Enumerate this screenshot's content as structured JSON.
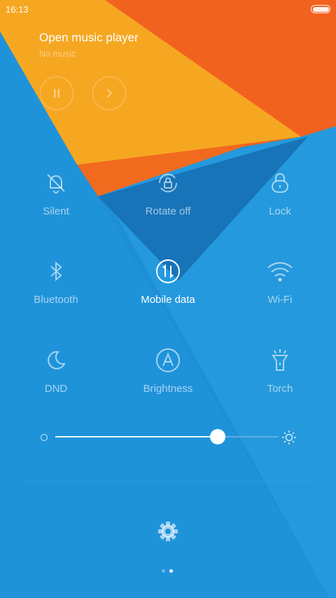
{
  "status_bar": {
    "time": "16:13",
    "battery_icon": "battery-icon"
  },
  "music": {
    "title": "Open music player",
    "subtitle": "No music",
    "pause_icon": "pause-icon",
    "next_icon": "next-icon"
  },
  "toggles": [
    {
      "label": "Silent",
      "icon": "bell-off-icon",
      "active": false
    },
    {
      "label": "Rotate off",
      "icon": "rotate-lock-icon",
      "active": false
    },
    {
      "label": "Lock",
      "icon": "lock-icon",
      "active": false
    },
    {
      "label": "Bluetooth",
      "icon": "bluetooth-icon",
      "active": false
    },
    {
      "label": "Mobile data",
      "icon": "mobile-data-icon",
      "active": true
    },
    {
      "label": "Wi-Fi",
      "icon": "wifi-icon",
      "active": false
    },
    {
      "label": "DND",
      "icon": "moon-icon",
      "active": false
    },
    {
      "label": "Brightness",
      "icon": "auto-brightness-icon",
      "active": false
    },
    {
      "label": "Torch",
      "icon": "torch-icon",
      "active": false
    }
  ],
  "brightness": {
    "level": 0.73,
    "min_icon": "brightness-low-icon",
    "max_icon": "brightness-high-icon"
  },
  "settings_icon": "gear-icon",
  "pager": {
    "pages": 2,
    "current": 2
  },
  "colors": {
    "blue": "#1E8FD8",
    "blue_dark": "#1678BE",
    "orange": "#F0611E",
    "yellow": "#F6A823"
  }
}
